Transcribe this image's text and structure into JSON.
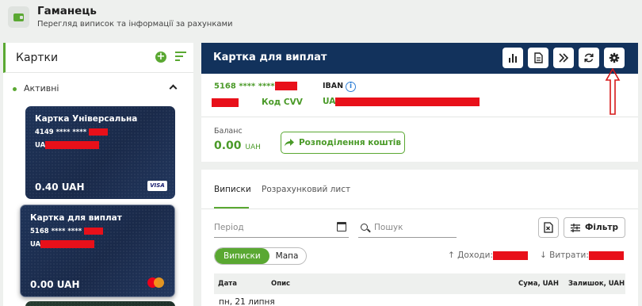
{
  "header": {
    "title": "Гаманець",
    "subtitle": "Перегляд виписок та інформації за рахунками"
  },
  "cards_panel": {
    "title": "Картки",
    "group_label": "Активні",
    "cards": [
      {
        "name": "Картка Універсальна",
        "number": "4149 **** ****",
        "iban_prefix": "UA",
        "balance": "0.40 UAH",
        "network": "VISA"
      },
      {
        "name": "Картка для виплат",
        "number": "5168 **** ****",
        "iban_prefix": "UA",
        "balance": "0.00 UAH",
        "network": "mastercard"
      }
    ]
  },
  "card_detail": {
    "title": "Картка для виплат",
    "number": "5168 **** ****",
    "cvv_link": "Код CVV",
    "iban_label": "IBAN",
    "iban_prefix": "UA",
    "balance_label": "Баланс",
    "balance_value": "0.00",
    "balance_currency": "UAH",
    "distribute_button": "Розподілення коштів",
    "toolbar_icons": [
      "chart-icon",
      "document-icon",
      "forward-icon",
      "refresh-icon",
      "settings-icon"
    ]
  },
  "statements": {
    "tabs": [
      "Виписки",
      "Розрахунковий лист"
    ],
    "period_placeholder": "Період",
    "search_placeholder": "Пошук",
    "filter_button": "Фільтр",
    "segments": [
      "Виписки",
      "Мапа"
    ],
    "income_label": "Доходи:",
    "expense_label": "Витрати:",
    "columns": [
      "Дата",
      "Опис",
      "Сума, UAH",
      "Залишок, UAH"
    ],
    "date_group": "пн, 21 липня"
  },
  "colors": {
    "accent_green": "#5aa832",
    "navy": "#12325c",
    "redaction": "#e8101a"
  }
}
